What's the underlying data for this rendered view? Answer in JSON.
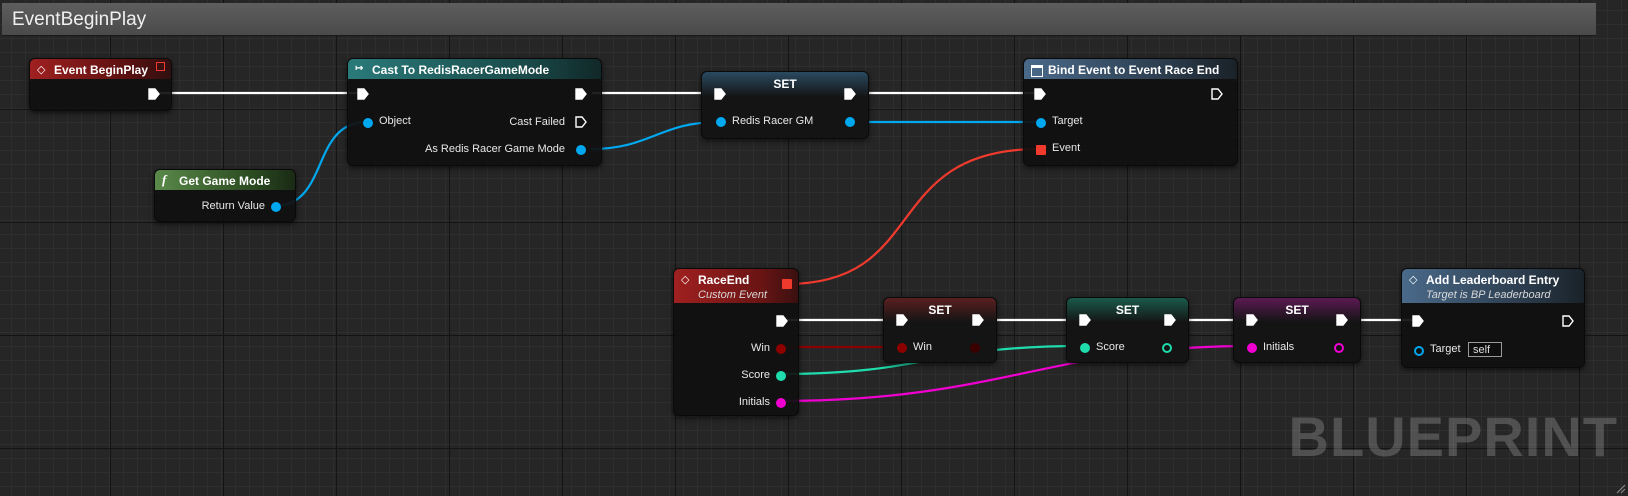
{
  "graph_title": "EventBeginPlay",
  "watermark": "BLUEPRINT",
  "colors": {
    "exec": "#ffffff",
    "object": "#00a8f0",
    "delegate": "#f03a2e",
    "boolean": "#8c0000",
    "number": "#1edcac",
    "string": "#f000d0"
  },
  "nodes": {
    "event_begin_play": {
      "title": "Event BeginPlay",
      "icon": "event-diamond-icon"
    },
    "get_game_mode": {
      "title": "Get Game Mode",
      "icon": "function-icon",
      "return_value": "Return Value"
    },
    "cast": {
      "title": "Cast To RedisRacerGameMode",
      "icon": "cast-arrow-icon",
      "object": "Object",
      "cast_failed": "Cast Failed",
      "as_output": "As Redis Racer Game Mode"
    },
    "set_gm": {
      "title": "SET",
      "var": "Redis Racer GM"
    },
    "bind_event": {
      "title": "Bind Event to Event Race End",
      "icon": "window-icon",
      "target": "Target",
      "event": "Event"
    },
    "race_end": {
      "title": "RaceEnd",
      "subtitle": "Custom Event",
      "icon": "event-diamond-icon",
      "win": "Win",
      "score": "Score",
      "initials": "Initials"
    },
    "set_win": {
      "title": "SET",
      "var": "Win"
    },
    "set_score": {
      "title": "SET",
      "var": "Score"
    },
    "set_initials": {
      "title": "SET",
      "var": "Initials"
    },
    "leaderboard": {
      "title": "Add Leaderboard Entry",
      "subtitle": "Target is BP Leaderboard",
      "icon": "function-diamond-icon",
      "target": "Target",
      "target_value": "self"
    }
  }
}
